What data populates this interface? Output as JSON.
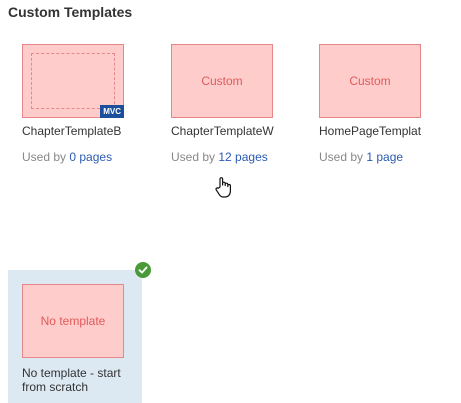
{
  "section": {
    "title": "Custom Templates"
  },
  "templates": [
    {
      "name": "ChapterTemplateB",
      "badge": "MVC",
      "usage_prefix": "Used by ",
      "usage_link": "0 pages"
    },
    {
      "name": "ChapterTemplateW",
      "thumb_label": "Custom",
      "usage_prefix": "Used by ",
      "usage_link": "12 pages"
    },
    {
      "name": "HomePageTemplat",
      "thumb_label": "Custom",
      "usage_prefix": "Used by ",
      "usage_link": "1 page"
    }
  ],
  "no_template": {
    "thumb_label": "No template",
    "name": "No template - start from scratch",
    "selected": true
  },
  "colors": {
    "thumb_fill": "#ffcccc",
    "thumb_border": "#e8878a",
    "link": "#2a5bb0",
    "selected_bg": "#dce9f3",
    "check": "#4a9a3a",
    "badge": "#1b4f9c"
  },
  "icons": [
    "check-circle-icon",
    "hand-cursor-icon"
  ]
}
